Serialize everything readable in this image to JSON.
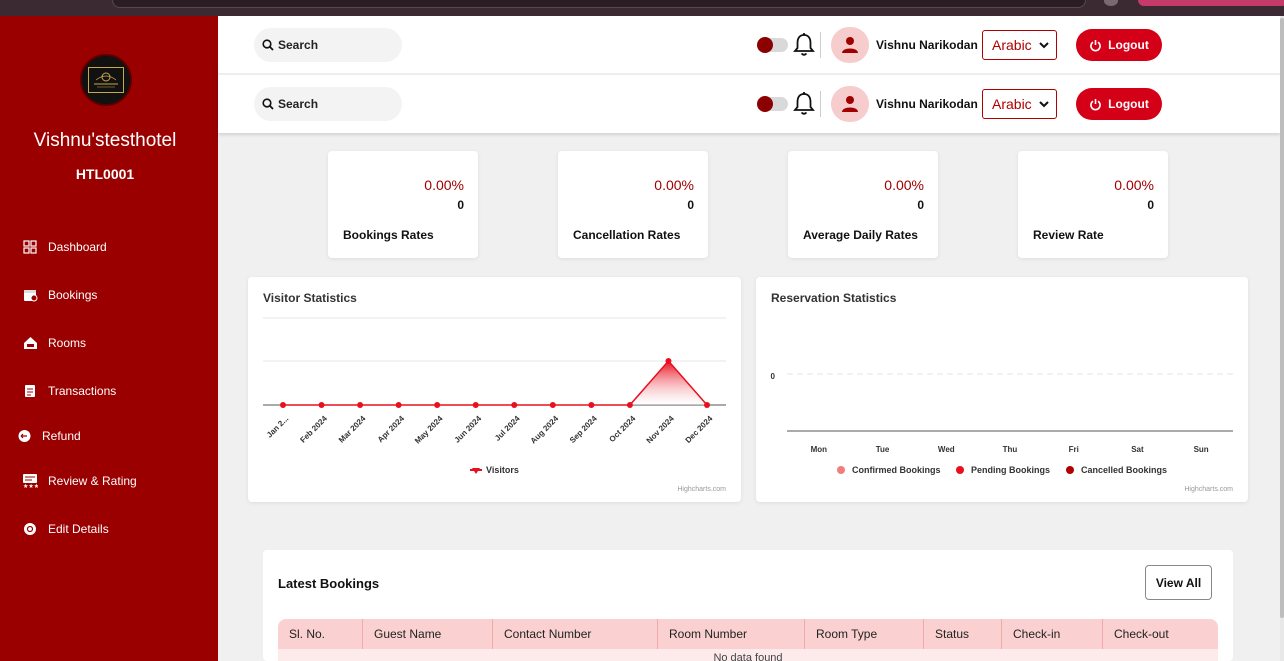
{
  "sidebar": {
    "hotel_name": "Vishnu'stesthotel",
    "hotel_code": "HTL0001",
    "items": [
      {
        "label": "Dashboard",
        "icon": "grid-icon"
      },
      {
        "label": "Bookings",
        "icon": "calendar-icon"
      },
      {
        "label": "Rooms",
        "icon": "room-icon"
      },
      {
        "label": "Transactions",
        "icon": "document-icon"
      },
      {
        "label": "Refund",
        "icon": "refund-icon"
      },
      {
        "label": "Review & Rating",
        "icon": "review-icon"
      },
      {
        "label": "Edit Details",
        "icon": "settings-icon"
      }
    ]
  },
  "header": {
    "search_label": "Search",
    "user_name": "Vishnu Narikodan",
    "language": "Arabic",
    "logout_label": "Logout"
  },
  "stats": [
    {
      "label": "Bookings Rates",
      "percent": "0.00%",
      "count": "0"
    },
    {
      "label": "Cancellation Rates",
      "percent": "0.00%",
      "count": "0"
    },
    {
      "label": "Average Daily Rates",
      "percent": "0.00%",
      "count": "0"
    },
    {
      "label": "Review Rate",
      "percent": "0.00%",
      "count": "0"
    }
  ],
  "visitor_chart": {
    "title": "Visitor Statistics",
    "credit": "Highcharts.com"
  },
  "reservation_chart": {
    "title": "Reservation Statistics",
    "credit": "Highcharts.com"
  },
  "chart_data": [
    {
      "type": "area",
      "title": "Visitor Statistics",
      "categories": [
        "Jan 2...",
        "Feb 2024",
        "Mar 2024",
        "Apr 2024",
        "May 2024",
        "Jun 2024",
        "Jul 2024",
        "Aug 2024",
        "Sep 2024",
        "Oct 2024",
        "Nov 2024",
        "Dec 2024"
      ],
      "series": [
        {
          "name": "Visitors",
          "values": [
            0,
            0,
            0,
            0,
            0,
            0,
            0,
            0,
            0,
            0,
            1,
            0
          ]
        }
      ],
      "grid": true,
      "legend": "bottom-center",
      "colors": {
        "Visitors": "#e8101e"
      }
    },
    {
      "type": "bar",
      "title": "Reservation Statistics",
      "categories": [
        "Mon",
        "Tue",
        "Wed",
        "Thu",
        "Fri",
        "Sat",
        "Sun"
      ],
      "y_tick_labels": [
        "0"
      ],
      "series": [
        {
          "name": "Confirmed Bookings",
          "values": [
            0,
            0,
            0,
            0,
            0,
            0,
            0
          ]
        },
        {
          "name": "Pending Bookings",
          "values": [
            0,
            0,
            0,
            0,
            0,
            0,
            0
          ]
        },
        {
          "name": "Cancelled Bookings",
          "values": [
            0,
            0,
            0,
            0,
            0,
            0,
            0
          ]
        }
      ],
      "legend": "bottom-center",
      "colors": {
        "Confirmed Bookings": "#f27d7d",
        "Pending Bookings": "#e8101e",
        "Cancelled Bookings": "#b00000"
      }
    }
  ],
  "latest_bookings": {
    "title": "Latest Bookings",
    "view_all_label": "View All",
    "columns": [
      "Sl. No.",
      "Guest Name",
      "Contact Number",
      "Room Number",
      "Room Type",
      "Status",
      "Check-in",
      "Check-out"
    ],
    "empty_text": "No data found"
  },
  "colors": {
    "brand": "#9a0000",
    "accent": "#d40018",
    "table_header": "#fbd0d0"
  }
}
